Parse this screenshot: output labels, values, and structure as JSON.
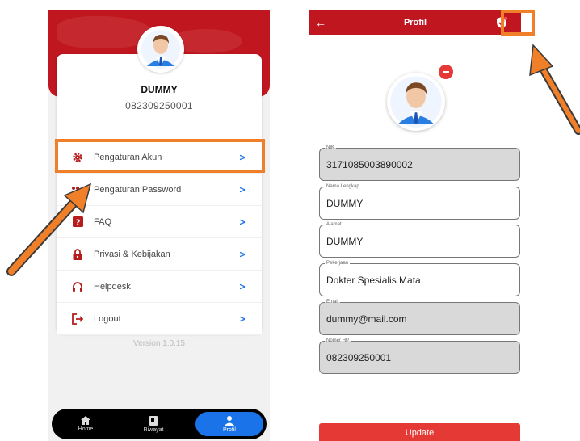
{
  "left_screen": {
    "user": {
      "name": "DUMMY",
      "phone": "082309250001"
    },
    "menu": [
      {
        "label": "Pengaturan Akun",
        "icon": "gear-icon"
      },
      {
        "label": "Pengaturan Password",
        "icon": "key-icon"
      },
      {
        "label": "FAQ",
        "icon": "question-icon"
      },
      {
        "label": "Privasi & Kebijakan",
        "icon": "lock-icon"
      },
      {
        "label": "Helpdesk",
        "icon": "headset-icon"
      },
      {
        "label": "Logout",
        "icon": "logout-icon"
      }
    ],
    "chevron": ">",
    "version": "Version 1.0.15",
    "nav": {
      "home": "Home",
      "riwayat": "Riwayat",
      "profil": "Profil"
    }
  },
  "right_screen": {
    "title": "Profil",
    "back_icon": "←",
    "fields": {
      "nik": {
        "label": "NIK",
        "value": "3171085003890002"
      },
      "nama": {
        "label": "Nama Lengkap",
        "value": "DUMMY"
      },
      "alamat": {
        "label": "Alamat",
        "value": "DUMMY"
      },
      "pekerjaan": {
        "label": "Pekerjaan",
        "value": "Dokter Spesialis Mata"
      },
      "email": {
        "label": "Email",
        "value": "dummy@mail.com"
      },
      "nomer_hp": {
        "label": "Nomer HP",
        "value": "082309250001"
      }
    },
    "update_label": "Update"
  },
  "colors": {
    "primary_red": "#c0161f",
    "accent_blue": "#1a73e8",
    "highlight_orange": "#f07f2a",
    "badge_red": "#e53935"
  }
}
